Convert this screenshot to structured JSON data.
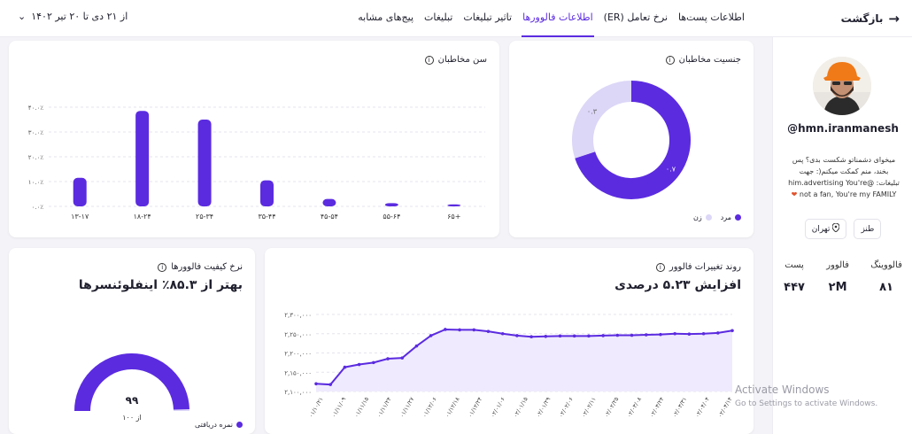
{
  "header": {
    "back_label": "بازگشت",
    "tabs": [
      {
        "label": "اطلاعات پست‌ها",
        "active": false
      },
      {
        "label": "نرخ تعامل (ER)",
        "active": false
      },
      {
        "label": "اطلاعات فالوورها",
        "active": true
      },
      {
        "label": "تاثیر تبلیغات",
        "active": false
      },
      {
        "label": "تبلیغات",
        "active": false
      },
      {
        "label": "پیج‌های مشابه",
        "active": false
      }
    ],
    "date_range": "از ۲۱ دی تا ۲۰ تیر ۱۴۰۲"
  },
  "profile": {
    "username": "@hmn.iranmanesh",
    "bio_lines": [
      "میخوای دشمناتو شکست بدی؟ پس",
      "بخند، منم کمکت میکنم(: جهت",
      "تبلیغات: @him.advertising You're",
      "not a fan, You're my FAMILY"
    ],
    "heart_icon": "heart-icon",
    "tags": [
      {
        "label": "طنز",
        "icon": ""
      },
      {
        "label": "تهران",
        "icon": "location-pin-icon"
      }
    ],
    "stats": [
      {
        "label": "فالووینگ",
        "value": "۸۱"
      },
      {
        "label": "فالوور",
        "value": "۲M"
      },
      {
        "label": "پست",
        "value": "۴۴۷"
      }
    ]
  },
  "cards": {
    "gender": {
      "title": "جنسیت مخاطبان"
    },
    "age": {
      "title": "سن مخاطبان"
    },
    "growth": {
      "title": "روند تغییرات فالوور",
      "headline": "افزایش ۵.۲۳ درصدی"
    },
    "quality": {
      "title": "نرخ کیفیت فالوورها",
      "headline": "بهتر از ۸۵.۳٪ اینفلوئنسرها"
    }
  },
  "watermark": {
    "title": "Activate Windows",
    "subtitle": "Go to Settings to activate Windows."
  },
  "colors": {
    "accent": "#5b2be0",
    "accent_light": "#dcd6f7",
    "area_fill": "#efeafd"
  },
  "chart_data": [
    {
      "type": "pie",
      "title": "جنسیت مخاطبان",
      "categories": [
        "مرد",
        "زن"
      ],
      "values": [
        0.7,
        0.3
      ],
      "value_labels": [
        "۰.۷",
        "۰.۳"
      ],
      "legend": [
        "مرد",
        "زن"
      ],
      "legend_position": "bottom-right"
    },
    {
      "type": "bar",
      "title": "سن مخاطبان",
      "categories": [
        "۱۳-۱۷",
        "۱۸-۲۴",
        "۲۵-۳۴",
        "۳۵-۴۴",
        "۴۵-۵۴",
        "۵۵-۶۴",
        "۶۵+"
      ],
      "values": [
        11.5,
        38.5,
        35,
        10.5,
        3,
        1.3,
        0.8
      ],
      "ylim": [
        0,
        40
      ],
      "yticks": [
        "۰.۰٪",
        "۱۰.۰٪",
        "۲۰.۰٪",
        "۳۰.۰٪",
        "۴۰.۰٪"
      ],
      "grid": true
    },
    {
      "type": "area",
      "title": "روند تغییرات فالوور",
      "x": [
        "۰۱/۱۰/۲۱",
        "۰۱/۱۰/۲۷",
        "۰۱/۱۱/۰۳",
        "۰۱/۱۱/۰۹",
        "۰۱/۱۱/۱۵",
        "۰۱/۱۱/۲۱",
        "۰۱/۱۱/۲۷",
        "۰۱/۱۲/۰۳",
        "۰۱/۱۲/۰۹",
        "۰۱/۱۲/۱۵",
        "۰۱/۱۲/۲۱",
        "۰۱/۱۲/۲۷",
        "۰۲/۰۱/۰۵",
        "۰۲/۰۱/۱۱",
        "۰۲/۰۱/۱۷",
        "۰۲/۰۱/۲۳",
        "۰۲/۰۱/۲۹",
        "۰۲/۰۲/۰۴",
        "۰۲/۰۲/۱۰",
        "۰۲/۰۲/۱۶",
        "۰۲/۰۲/۲۲",
        "۰۲/۰۲/۲۸",
        "۰۲/۰۳/۰۳",
        "۰۲/۰۳/۰۹",
        "۰۲/۰۳/۱۵",
        "۰۲/۰۳/۲۱",
        "۰۲/۰۳/۲۷",
        "۰۲/۰۴/۰۲",
        "۰۲/۰۴/۰۸",
        "۰۲/۰۴/۱۴"
      ],
      "x_tick_labels": [
        "۰۱/۱۰/۲۱",
        "۰۱/۱۱/۰۹",
        "۰۱/۱۱/۱۵",
        "۰۱/۱۱/۲۴",
        "۰۱/۱۱/۲۷",
        "۰۱/۱۲/۰۶",
        "۰۱/۱۲/۱۸",
        "۰۱/۱۲/۲۴",
        "۰۲/۰۱/۰۶",
        "۰۲/۰۱/۱۵",
        "۰۲/۰۱/۲۹",
        "۰۲/۰۲/۰۶",
        "۰۲/۰۲/۱۱",
        "۰۲/۰۲/۲۵",
        "۰۲/۰۳/۰۸",
        "۰۲/۰۳/۲۴",
        "۰۲/۰۳/۳۱",
        "۰۲/۰۴/۰۴",
        "۰۲/۰۴/۱۴"
      ],
      "values": [
        2120000,
        2118000,
        2163000,
        2170000,
        2175000,
        2185000,
        2187000,
        2218000,
        2245000,
        2261000,
        2260000,
        2260000,
        2256000,
        2250000,
        2245000,
        2242000,
        2243000,
        2244000,
        2244000,
        2244000,
        2245000,
        2246000,
        2246000,
        2247000,
        2248000,
        2250000,
        2249000,
        2250000,
        2252000,
        2258000
      ],
      "ylim": [
        2100000,
        2300000
      ],
      "yticks": [
        "۲,۱۰۰,۰۰۰",
        "۲,۱۵۰,۰۰۰",
        "۲,۲۰۰,۰۰۰",
        "۲,۲۵۰,۰۰۰",
        "۲,۳۰۰,۰۰۰"
      ],
      "grid": true
    },
    {
      "type": "gauge",
      "title": "نرخ کیفیت فالوورها",
      "value": 99,
      "max": 100,
      "value_label": "۹۹",
      "max_label": "از ۱۰۰",
      "legend": [
        "نمره دریافتی"
      ]
    }
  ]
}
